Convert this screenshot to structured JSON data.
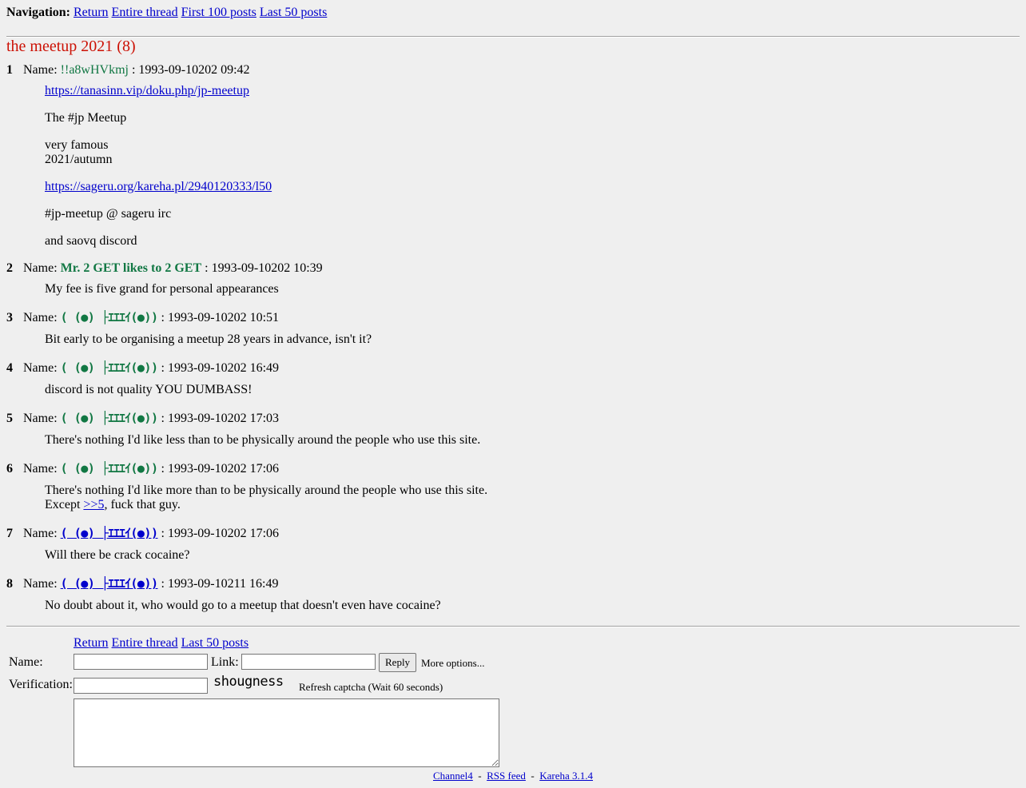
{
  "navigation": {
    "label": "Navigation:",
    "links": [
      "Return",
      "Entire thread",
      "First 100 posts",
      "Last 50 posts"
    ]
  },
  "thread": {
    "title": "the meetup 2021 (8)"
  },
  "posts": [
    {
      "num": "1",
      "name_label": "Name:",
      "name": "!!a8wHVkmj",
      "date": ": 1993-09-10202 09:42",
      "body": {
        "link1": "https://tanasinn.vip/doku.php/jp-meetup",
        "line1": "The #jp Meetup",
        "line2": "very famous",
        "line3": "2021/autumn",
        "link2": "https://sageru.org/kareha.pl/2940120333/l50",
        "line4": "#jp-meetup @ sageru irc",
        "line5": "and saovq discord"
      }
    },
    {
      "num": "2",
      "name_label": "Name:",
      "name": "Mr. 2 GET likes to 2 GET",
      "date": ": 1993-09-10202 10:39",
      "body": {
        "line1": "My fee is five grand for personal appearances"
      }
    },
    {
      "num": "3",
      "name_label": "Name:",
      "name": "( (●) ├ｴｴｴｲ(●))",
      "date": ": 1993-09-10202 10:51",
      "body": {
        "line1": "Bit early to be organising a meetup 28 years in advance, isn't it?"
      }
    },
    {
      "num": "4",
      "name_label": "Name:",
      "name": "( (●) ├ｴｴｴｲ(●))",
      "date": ": 1993-09-10202 16:49",
      "body": {
        "line1": "discord is not quality YOU DUMBASS!"
      }
    },
    {
      "num": "5",
      "name_label": "Name:",
      "name": "( (●) ├ｴｴｴｲ(●))",
      "date": ": 1993-09-10202 17:03",
      "body": {
        "line1": "There's nothing I'd like less than to be physically around the people who use this site."
      }
    },
    {
      "num": "6",
      "name_label": "Name:",
      "name": "( (●) ├ｴｴｴｲ(●))",
      "date": ": 1993-09-10202 17:06",
      "body": {
        "line1": "There's nothing I'd like more than to be physically around the people who use this site.",
        "line2_pre": "Except ",
        "line2_link": ">>5",
        "line2_post": ", fuck that guy."
      }
    },
    {
      "num": "7",
      "name_label": "Name:",
      "name": "( (●) ├ｴｴｴｲ(●))",
      "date": ": 1993-09-10202 17:06",
      "body": {
        "line1": "Will there be crack cocaine?"
      }
    },
    {
      "num": "8",
      "name_label": "Name:",
      "name": "( (●) ├ｴｴｴｲ(●))",
      "date": ": 1993-09-10211 16:49",
      "body": {
        "line1": "No doubt about it, who would go to a meetup that doesn't even have cocaine?"
      }
    }
  ],
  "reply_form": {
    "links": [
      "Return",
      "Entire thread",
      "Last 50 posts"
    ],
    "name_label": "Name:",
    "link_label": "Link:",
    "reply_button": "Reply",
    "more_options": "More options...",
    "verification_label": "Verification:",
    "captcha_text": "shougness",
    "refresh_captcha": "Refresh captcha (Wait 60 seconds)",
    "name_value": "",
    "link_value": "",
    "verification_value": "",
    "message_value": ""
  },
  "footer": {
    "links": [
      "Channel4",
      "RSS feed",
      "Kareha 3.1.4"
    ],
    "separator": "-"
  },
  "colors": {
    "background": "#efefef",
    "title": "#cc1105",
    "name": "#117743",
    "link": "#0000cc"
  }
}
